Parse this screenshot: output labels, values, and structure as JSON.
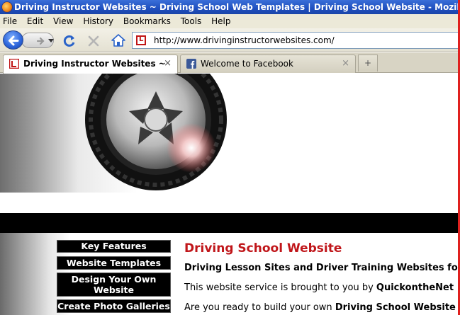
{
  "window": {
    "title": "Driving Instructor Websites ~ Driving School Web Templates | Driving School Website - Mozilla Firefox"
  },
  "menu": [
    "File",
    "Edit",
    "View",
    "History",
    "Bookmarks",
    "Tools",
    "Help"
  ],
  "navbar": {
    "url": "http://www.drivinginstructorwebsites.com/"
  },
  "tabs": [
    {
      "label": "Driving Instructor Websites ~ Dri...",
      "active": true,
      "close": "×"
    },
    {
      "label": "Welcome to Facebook",
      "active": false,
      "close": "×"
    }
  ],
  "newtab_glyph": "+",
  "page": {
    "nav": [
      "Key Features",
      "Website Templates",
      "Design Your Own Website",
      "Create Photo Galleries"
    ],
    "title": "Driving School Website",
    "subtitle": "Driving Lesson Sites and Driver Training Websites for",
    "para1_prefix": "This website service is brought to you by ",
    "para1_bold": "QuickontheNet",
    "para2_prefix": "Are you ready to build your own ",
    "para2_bold": "Driving School Website"
  },
  "colors": {
    "accent_red": "#c0161a",
    "titlebar_blue": "#1f4fbf"
  }
}
